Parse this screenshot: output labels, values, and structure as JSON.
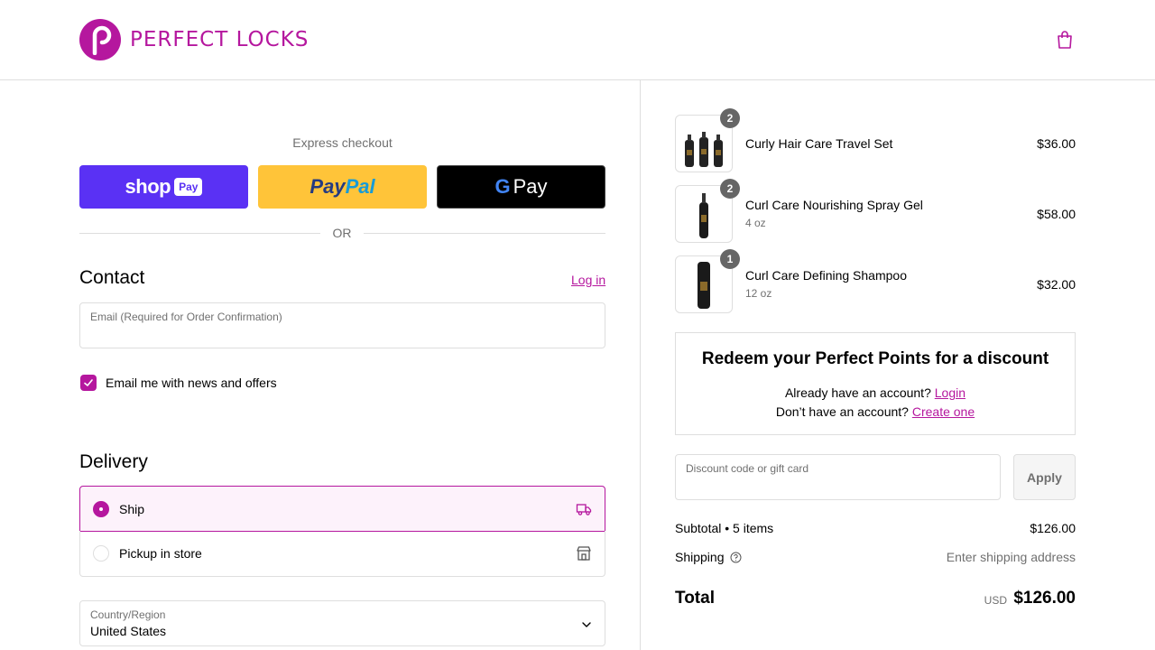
{
  "header": {
    "brand": "PERFECT LOCKS",
    "logo_letter": "P",
    "cart_icon": "shopping-bag-icon"
  },
  "express": {
    "title": "Express checkout",
    "shop_pay_label": "shop",
    "shop_pay_pill": "Pay",
    "paypal_part1": "Pay",
    "paypal_part2": "Pal",
    "gpay_g": "G",
    "gpay_label": "Pay",
    "or_text": "OR"
  },
  "contact": {
    "title": "Contact",
    "login_link": "Log in",
    "email_label": "Email (Required for Order Confirmation)",
    "email_value": "",
    "newsletter_label": "Email me with news and offers",
    "newsletter_checked": true
  },
  "delivery": {
    "title": "Delivery",
    "options": [
      {
        "label": "Ship",
        "selected": true,
        "icon": "truck-icon"
      },
      {
        "label": "Pickup in store",
        "selected": false,
        "icon": "store-icon"
      }
    ],
    "country_label": "Country/Region",
    "country_value": "United States"
  },
  "cart": {
    "items": [
      {
        "name": "Curly Hair Care Travel Set",
        "variant": "",
        "qty": "2",
        "price": "$36.00"
      },
      {
        "name": "Curl Care Nourishing Spray Gel",
        "variant": "4 oz",
        "qty": "2",
        "price": "$58.00"
      },
      {
        "name": "Curl Care Defining Shampoo",
        "variant": "12 oz",
        "qty": "1",
        "price": "$32.00"
      }
    ]
  },
  "redeem": {
    "title": "Redeem your Perfect Points for a discount",
    "line1_text": "Already have an account?",
    "line1_link": "Login",
    "line2_text": "Don’t have an account?",
    "line2_link": "Create one"
  },
  "discount": {
    "placeholder": "Discount code or gift card",
    "apply_label": "Apply"
  },
  "summary": {
    "subtotal_label": "Subtotal • 5 items",
    "subtotal_value": "$126.00",
    "shipping_label": "Shipping",
    "shipping_value": "Enter shipping address",
    "total_label": "Total",
    "currency": "USD",
    "total_value": "$126.00"
  },
  "colors": {
    "accent": "#b5179e",
    "shop_pay": "#5a31f4",
    "paypal": "#ffc439",
    "gpay": "#000000"
  }
}
